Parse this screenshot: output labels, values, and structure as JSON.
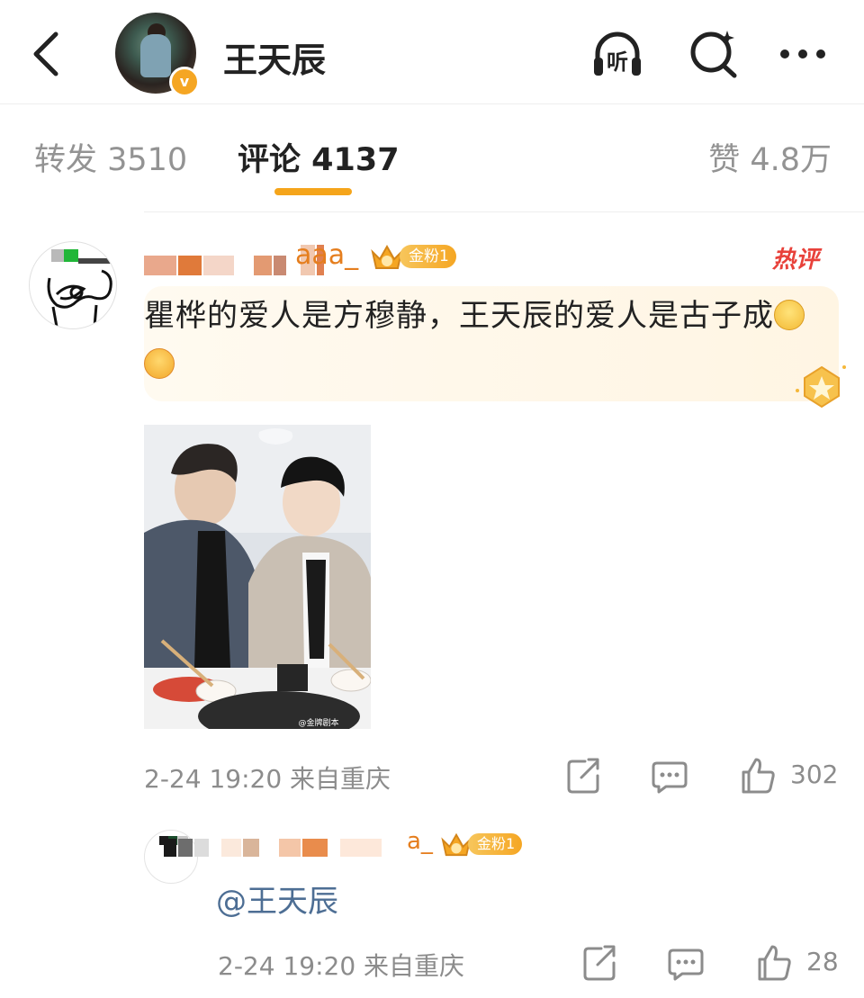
{
  "header": {
    "title": "王天辰",
    "verified_mark": "v",
    "listen_label": "听",
    "icons": [
      "back-chevron-icon",
      "listen-headphones-icon",
      "search-icon",
      "more-dots-icon"
    ]
  },
  "tabs": {
    "repost": "转发 3510",
    "comments": "评论 4137",
    "likes": "赞 4.8万",
    "active_color": "#f5a51b"
  },
  "comment": {
    "username_visible": "aaa_",
    "fan_badge": "金粉1",
    "hot_tag": "热评",
    "text": "瞿桦的爱人是方穆静，王天辰的爱人是古子成",
    "emojis": [
      "nerd-glasses-emoji",
      "heart-eyes-emoji"
    ],
    "photo_watermark": "@金牌剧本",
    "timestamp": "2-24 19:20",
    "location": "来自重庆",
    "likes": "302"
  },
  "reply": {
    "username_visible": "a_",
    "fan_badge": "金粉1",
    "text": "@王天辰",
    "timestamp": "2-24 19:20",
    "location": "来自重庆",
    "likes": "28"
  },
  "colors": {
    "accent_gold": "#f5a623",
    "hot_red": "#e8413a",
    "link_blue": "#4d6e94",
    "meta_gray": "#8c8c8c"
  }
}
